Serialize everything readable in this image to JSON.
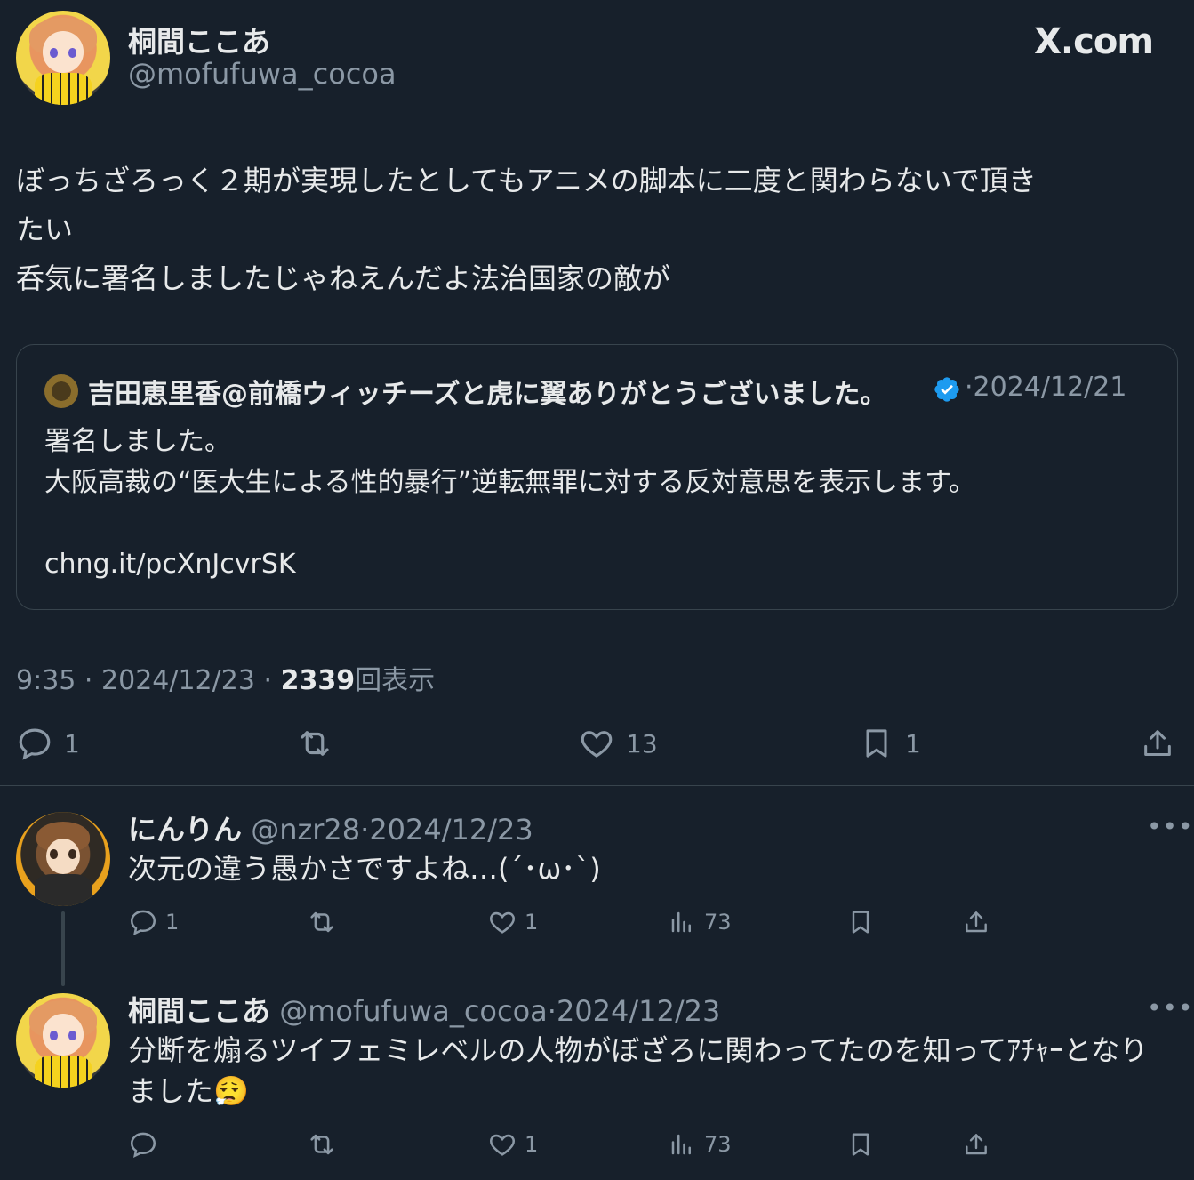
{
  "brand": {
    "logo_text": "X.com"
  },
  "main_tweet": {
    "author_name": "桐間ここあ",
    "author_handle": "@mofufuwa_cocoa",
    "text": "ぼっちざろっく２期が実現したとしてもアニメの脚本に二度と関わらないで頂き\nたい\n呑気に署名しましたじゃねえんだよ法治国家の敵が",
    "time": "9:35",
    "date": "2024/12/23",
    "views_count": "2339",
    "views_label": "回表示",
    "separator": "·",
    "actions": {
      "reply_count": "1",
      "retweet_count": "",
      "like_count": "13",
      "bookmark_count": "1"
    }
  },
  "quoted_tweet": {
    "author_name": "吉田恵里香@前橋ウィッチーズと虎に翼ありがとうございました。",
    "date": "2024/12/21",
    "text": "署名しました。\n大阪高裁の“医大生による性的暴行”逆転無罪に対する反対意思を表示します。\n\nchng.it/pcXnJcvrSK"
  },
  "replies": [
    {
      "author_name": "にんりん",
      "author_handle": "@nzr28",
      "date": "2024/12/23",
      "text": "次元の違う愚かさですよね…(´･ω･`)",
      "reply_count": "1",
      "like_count": "1",
      "views_count": "73"
    },
    {
      "author_name": "桐間ここあ",
      "author_handle": "@mofufuwa_cocoa",
      "date": "2024/12/23",
      "text": "分断を煽るツイフェミレベルの人物がぼざろに関わってたのを知ってｱﾁｬｰとなり\nました😮‍💨",
      "reply_count": "",
      "like_count": "1",
      "views_count": "73"
    }
  ],
  "more_label": "•••",
  "colors": {
    "background": "#17202b",
    "text": "#e7e9ea",
    "muted": "#8b98a5",
    "border": "#38444d",
    "verified": "#1d9bf0"
  }
}
